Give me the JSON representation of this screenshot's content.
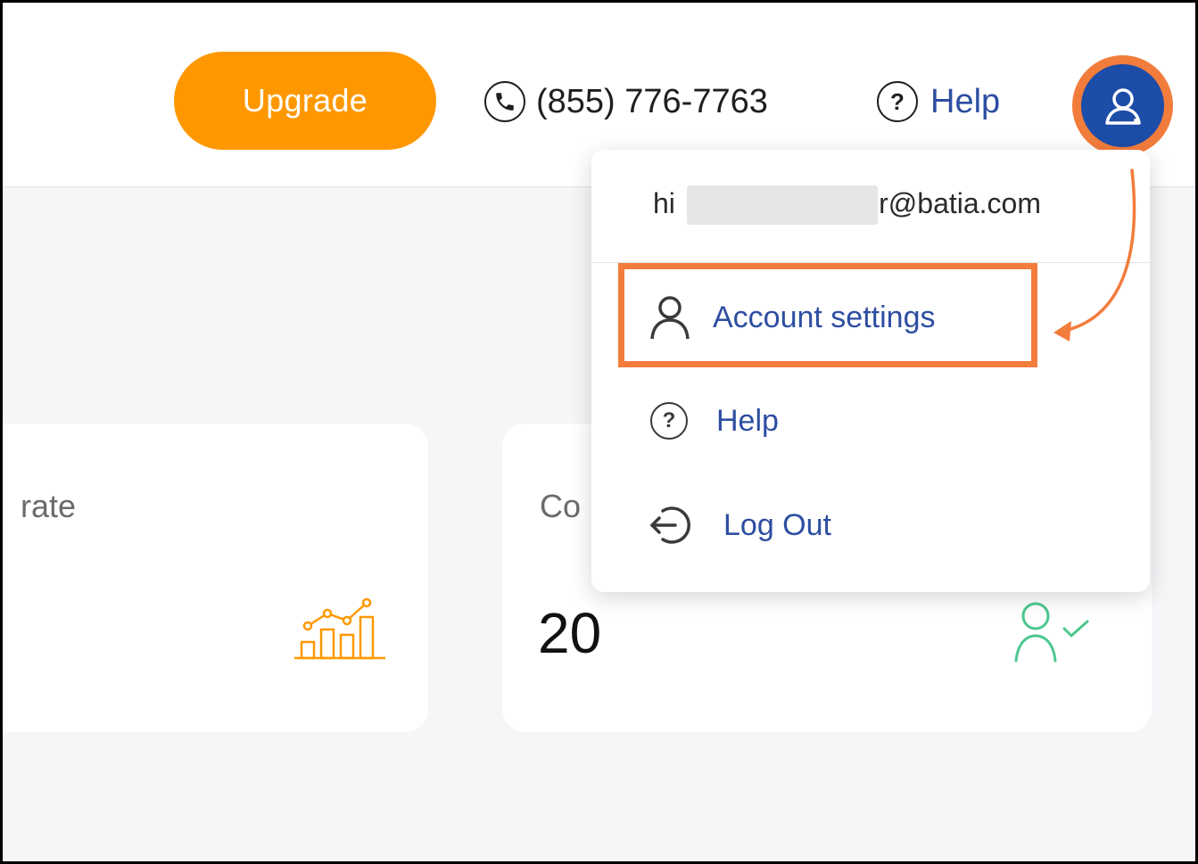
{
  "header": {
    "upgrade_label": "Upgrade",
    "phone": "(855) 776-7763",
    "help_label": "Help",
    "help_icon_glyph": "?"
  },
  "account_menu": {
    "email_prefix": "hi",
    "email_suffix": "lir@batia.com",
    "items": [
      {
        "label": "Account settings",
        "icon": "person-icon"
      },
      {
        "label": "Help",
        "icon": "question-icon",
        "glyph": "?"
      },
      {
        "label": "Log Out",
        "icon": "logout-icon"
      }
    ]
  },
  "stats": [
    {
      "title": "rate",
      "icon": "chart-icon"
    },
    {
      "title": "Co",
      "value": "20",
      "icon": "user-check-icon"
    }
  ],
  "colors": {
    "accent_orange": "#ff9800",
    "annotation_orange": "#f27c3c",
    "avatar_blue": "#1c4da8",
    "link_blue": "#2d4ea1",
    "success_green": "#4cc790"
  }
}
